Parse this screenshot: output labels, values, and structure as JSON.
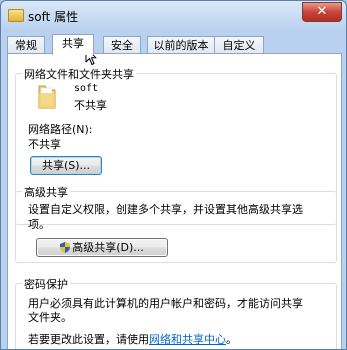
{
  "window": {
    "title": "soft 属性",
    "close_glyph": "✕"
  },
  "tabs": [
    {
      "label": "常规"
    },
    {
      "label": "共享"
    },
    {
      "label": "安全"
    },
    {
      "label": "以前的版本"
    },
    {
      "label": "自定义"
    }
  ],
  "share_section": {
    "title": "网络文件和文件夹共享",
    "folder_name": "soft",
    "status": "不共享",
    "path_label": "网络路径(N):",
    "path_value": "不共享",
    "share_button": "共享(S)..."
  },
  "advanced_section": {
    "title": "高级共享",
    "description_line1": "设置自定义权限，创建多个共享，并设置其他高级共享选",
    "description_line2": "项。",
    "button": "高级共享(D)..."
  },
  "password_section": {
    "title": "密码保护",
    "description_line1": "用户必须具有此计算机的用户帐户和密码，才能访问共享",
    "description_line2": "文件夹。",
    "change_text": "若要更改此设置，请使用",
    "link_text": "网络和共享中心",
    "change_suffix": "。"
  }
}
